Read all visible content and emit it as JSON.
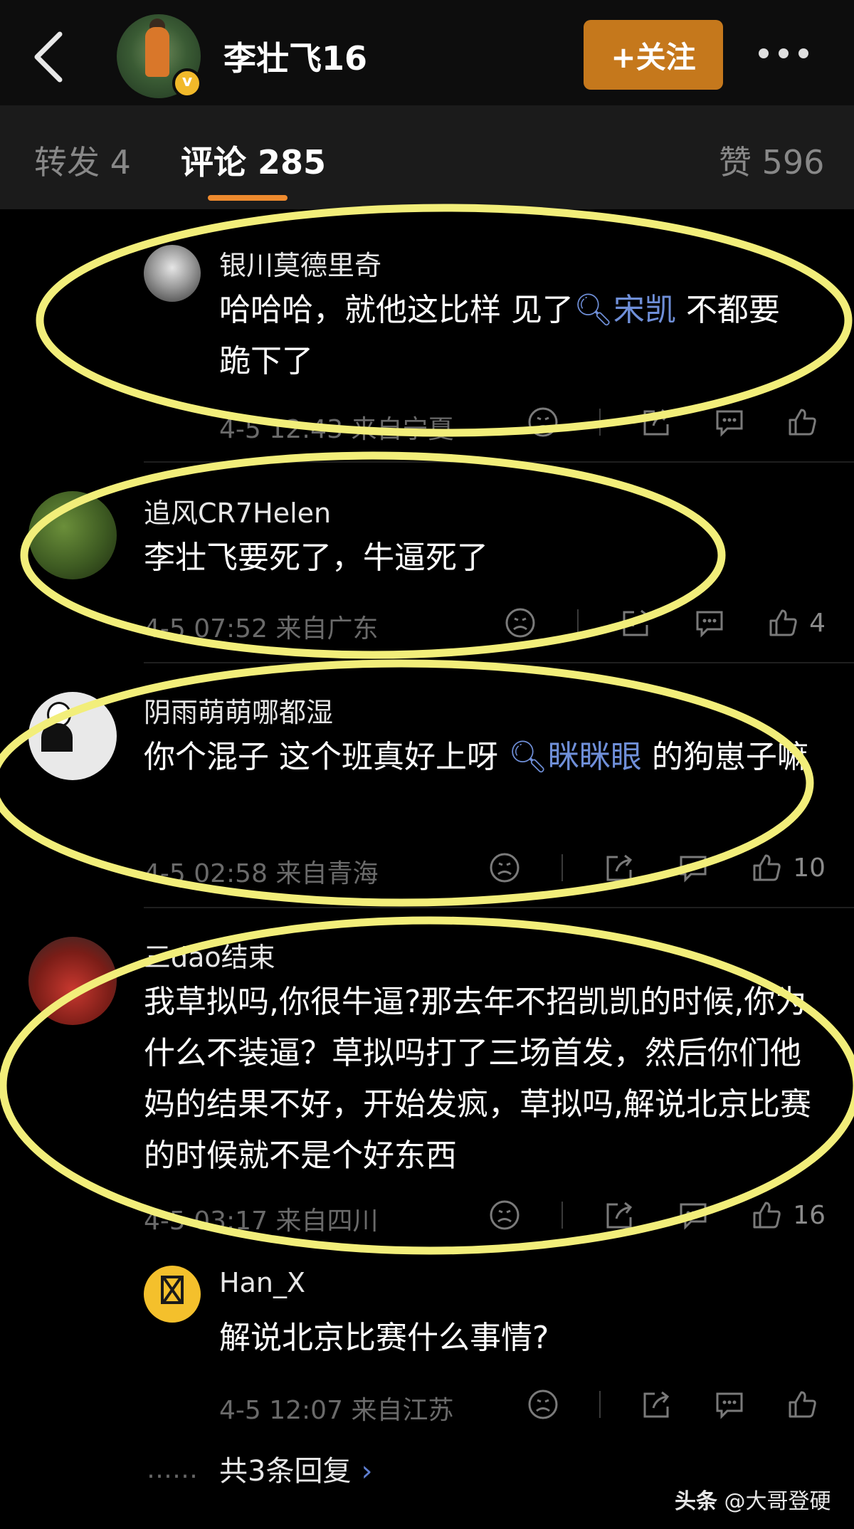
{
  "header": {
    "title": "李壮飞16",
    "follow_label": "+关注",
    "back_icon": "chevron-left-icon",
    "more_icon": "more-dots-icon"
  },
  "tabs": {
    "repost": "转发 4",
    "comments": "评论 285",
    "likes": "赞 596"
  },
  "comments": [
    {
      "user": "银川莫德里奇",
      "text_before": "哈哈哈，就他这比样 见了",
      "search_term": "宋凯",
      "text_after": " 不都要跪下了",
      "time": "4-5 12:43",
      "location": "来自宁夏",
      "likes": ""
    },
    {
      "user": "追风CR7Helen",
      "text": "李壮飞要死了，牛逼死了",
      "time": "4-5 07:52",
      "location": "来自广东",
      "likes": "4"
    },
    {
      "user": "阴雨萌萌哪都湿",
      "text_before": "你个混子 这个班真好上呀 ",
      "search_term": "眯眯眼",
      "text_after": " 的狗崽子嘛",
      "time": "4-5 02:58",
      "location": "来自青海",
      "likes": "10"
    },
    {
      "user": "三dao结束",
      "text": "我草拟吗,你很牛逼?那去年不招凯凯的时候,你为什么不装逼？草拟吗打了三场首发，然后你们他妈的结果不好，开始发疯，草拟吗,解说北京比赛的时候就不是个好东西",
      "time": "4-5 03:17",
      "location": "来自四川",
      "likes": "16"
    }
  ],
  "reply": {
    "user": "Han_X",
    "text": "解说北京比赛什么事情?",
    "time": "4-5 12:07",
    "location": "来自江苏",
    "likes": ""
  },
  "more_replies": "共3条回复",
  "watermark": {
    "brand": "头条",
    "handle": "@大哥登硬"
  },
  "colors": {
    "accent": "#ee8a2e",
    "follow_bg": "#c5781c",
    "annotation": "#f2ee7a",
    "search_link": "#6f8fd8"
  }
}
